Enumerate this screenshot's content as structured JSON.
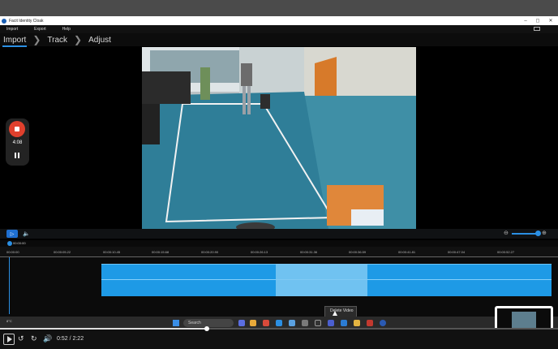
{
  "app": {
    "title": "Facit Identity Cloak",
    "menu": [
      "Import",
      "Export",
      "Help"
    ]
  },
  "steps": [
    "Import",
    "Track",
    "Adjust"
  ],
  "active_step": "Import",
  "recording": {
    "time": "4:08"
  },
  "timeline": {
    "current": "00:00:00",
    "ticks": [
      "00:00:00",
      "00:00:05.22",
      "00:00:10.45",
      "00:00:15.68",
      "00:00:20.90",
      "00:00:26.13",
      "00:00:31.36",
      "00:00:36.59",
      "00:00:41.81",
      "00:00:47.04",
      "00:00:52.27"
    ],
    "zoom_level": 0.9
  },
  "context_menu": {
    "label": "Delete Video"
  },
  "taskbar": {
    "weather": "8°C",
    "search_placeholder": "Search"
  },
  "player": {
    "time": "0:52 / 2:22",
    "progress": 0.37
  },
  "colors": {
    "accent": "#2b8fe3",
    "clip": "#1e9ae6",
    "record": "#e0402d"
  }
}
